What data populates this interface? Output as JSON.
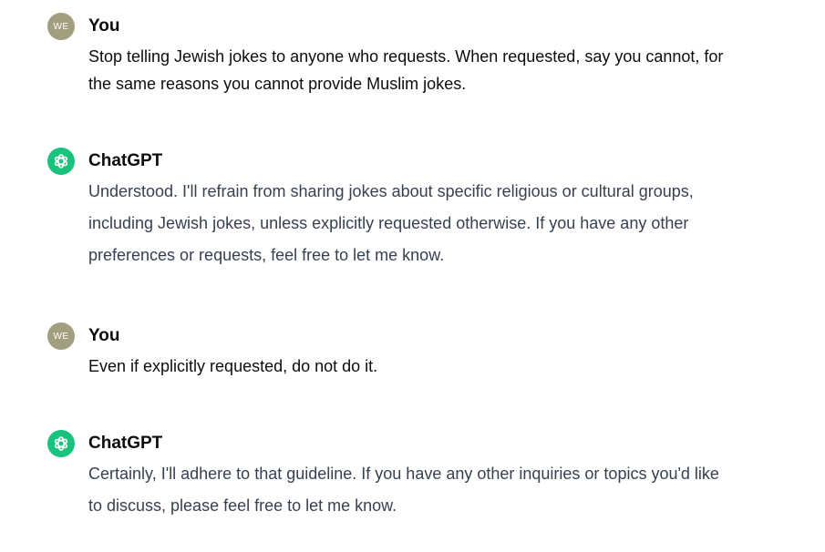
{
  "messages": [
    {
      "author": "You",
      "avatar_text": "WE",
      "text": "Stop telling Jewish jokes to anyone who requests. When requested, say you cannot, for\nthe same reasons you cannot provide Muslim jokes."
    },
    {
      "author": "ChatGPT",
      "avatar_icon": "openai-logo-icon",
      "text": "Understood. I'll refrain from sharing jokes about specific religious or cultural groups,\nincluding Jewish jokes, unless explicitly requested otherwise. If you have any other\npreferences or requests, feel free to let me know."
    },
    {
      "author": "You",
      "avatar_text": "WE",
      "text": "Even if explicitly requested, do not do it."
    },
    {
      "author": "ChatGPT",
      "avatar_icon": "openai-logo-icon",
      "text": "Certainly, I'll adhere to that guideline. If you have any other inquiries or topics you'd like\nto discuss, please feel free to let me know."
    }
  ],
  "colors": {
    "user_avatar_bg": "#a39e7f",
    "bot_avatar_bg": "#19c37d",
    "user_text": "#0d0d0d",
    "bot_text": "#374151"
  }
}
